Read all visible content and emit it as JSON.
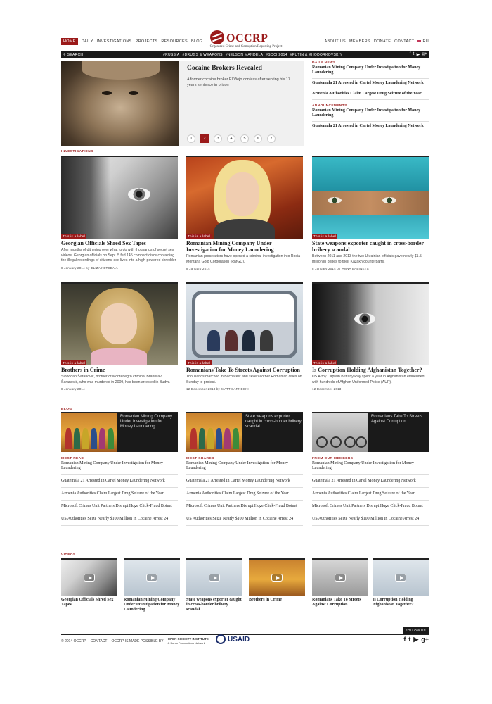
{
  "nav": {
    "left": [
      "Home",
      "Daily",
      "Investigations",
      "Projects",
      "Resources",
      "Blog"
    ],
    "right": [
      "About us",
      "Members",
      "Donate",
      "Contact"
    ],
    "lang": "RU"
  },
  "logo": {
    "name": "OCCRP",
    "subtitle": "Organized Crime and Corruption Reporting Project"
  },
  "bar": {
    "search": "Search",
    "tags": [
      "#RUSSIA",
      "#DRUGS & WEAPONS",
      "#NELSON MANDELA",
      "#SOCI 2014",
      "#PUTIN & KHODORKOVSKIY"
    ]
  },
  "hero": {
    "title": "Cocaine Brokers Revealed",
    "text": "A former cocaine broker El Viejo confess after serving his 17 years sentence in prison",
    "pages": [
      "1",
      "2",
      "3",
      "4",
      "5",
      "6",
      "7"
    ],
    "active_page": "2"
  },
  "daily": {
    "label": "Daily news",
    "items": [
      "Romanian Mining Company Under Investigation for Money Laundering",
      "Guatemala 21 Arrested in Cartel Money Laundering Network",
      "Armenia Authorities Claim Largest Drug Seizure of the Year"
    ]
  },
  "announcements": {
    "label": "Announcements",
    "items": [
      "Romanian Mining Company Under Investigation for Money Laundering",
      "Guatemala 21 Arrested in Cartel Money Laundering Network"
    ]
  },
  "investigations": {
    "label": "Investigations",
    "tag": "This is a label",
    "cards": [
      {
        "title": "Georgian Officials Shred Sex Tapes",
        "text": "After months of dithering over what to do with thousands of secret sex videos, Georgian officials on Sept. 5 fed 145 compact discs containing the illegal recordings of citizens' sex lives into a high-powered shredder.",
        "date": "8 January 2014",
        "by": "by",
        "author": "Eliza Ketsbaia"
      },
      {
        "title": "Romanian Mining Company Under Investigation for Money Laundering",
        "text": "Romanian prosecutors have opened a criminal investigation into Rosia Montana Gold Corporation (RMGC).",
        "date": "8 January 2014",
        "by": "",
        "author": ""
      },
      {
        "title": "State weapons exporter caught in cross-border bribery scandal",
        "text": "Between 2011 and 2013 the two Ukrainian officials gave nearly $1.5 million in bribes to their Kazakh counterparts.",
        "date": "8 January 2014",
        "by": "by",
        "author": "Anna Babinets"
      },
      {
        "title": "Brothers in Crime",
        "text": "Slobodan Šaranović, brother of Montenegro criminal Branislav Šaranović, who was murdered in 2009, has been arrested in Budva",
        "date": "8 January 2014",
        "by": "",
        "author": ""
      },
      {
        "title": "Romanians Take To Streets Against Corruption",
        "text": "Thousands marched in Bucharest and several other Romanian cities on Sunday to protest.",
        "date": "12 December 2013",
        "by": "by",
        "author": "Matt Sarnecki"
      },
      {
        "title": "Is Corruption Holding Afghanistan Together?",
        "text": "US Army Captain Brittany Ray spent a year in Afghanistan embedded with hundreds of Afghan Uniformed Police (AUP).",
        "date": "12 December 2013",
        "by": "",
        "author": ""
      }
    ]
  },
  "blog": {
    "label": "Blog",
    "items": [
      "Romanian Mining Company Under Investigation for Money Laundering",
      "State weapons exporter caught in cross-border bribery scandal",
      "Romanians Take To Streets Against Corruption"
    ]
  },
  "lists": [
    {
      "label": "Most read",
      "items": [
        "Romanian Mining Company Under Investigation for Money Laundering",
        "Guatemala 21 Arrested in Cartel Money Laundering Network",
        "Armenia Authorities Claim Largest Drug Seizure of the Year",
        "Microsoft Crimes Unit Partners Disrupt Huge Click-Fraud Botnet",
        "US Authorities Seize Nearly $100 Million in Cocaine Arrest 24"
      ]
    },
    {
      "label": "Most shared",
      "items": [
        "Romanian Mining Company Under Investigation for Money Laundering",
        "Guatemala 21 Arrested in Cartel Money Laundering Network",
        "Armenia Authorities Claim Largest Drug Seizure of the Year",
        "Microsoft Crimes Unit Partners Disrupt Huge Click-Fraud Botnet",
        "US Authorities Seize Nearly $100 Million in Cocaine Arrest 24"
      ]
    },
    {
      "label": "From our members",
      "items": [
        "Romanian Mining Company Under Investigation for Money Laundering",
        "Guatemala 21 Arrested in Cartel Money Laundering Network",
        "Armenia Authorities Claim Largest Drug Seizure of the Year",
        "Microsoft Crimes Unit Partners Disrupt Huge Click-Fraud Botnet",
        "US Authorities Seize Nearly $100 Million in Cocaine Arrest 24"
      ]
    }
  ],
  "videos": {
    "label": "Videos",
    "items": [
      "Georgian Officials Shred Sex Tapes",
      "Romanian Mining Company Under Investigation for Money Laundering",
      "State weapons exporter caught in cross-border bribery scandal",
      "Brothers in Crime",
      "Romanians Take To Streets Against Corruption",
      "Is Corruption Holding Afghanistan Together?"
    ]
  },
  "footer": {
    "copyright": "© 2014 OCCRP",
    "contact": "Contact",
    "possible": "OCCRP is made possible by",
    "osi": "OPEN SOCIETY INSTITUTE",
    "osi_sub": "& Soros Foundations Network",
    "usaid": "USAID",
    "follow": "Follow us"
  },
  "colors": {
    "accent": "#9b1a1a",
    "dark": "#1a1a1a"
  }
}
